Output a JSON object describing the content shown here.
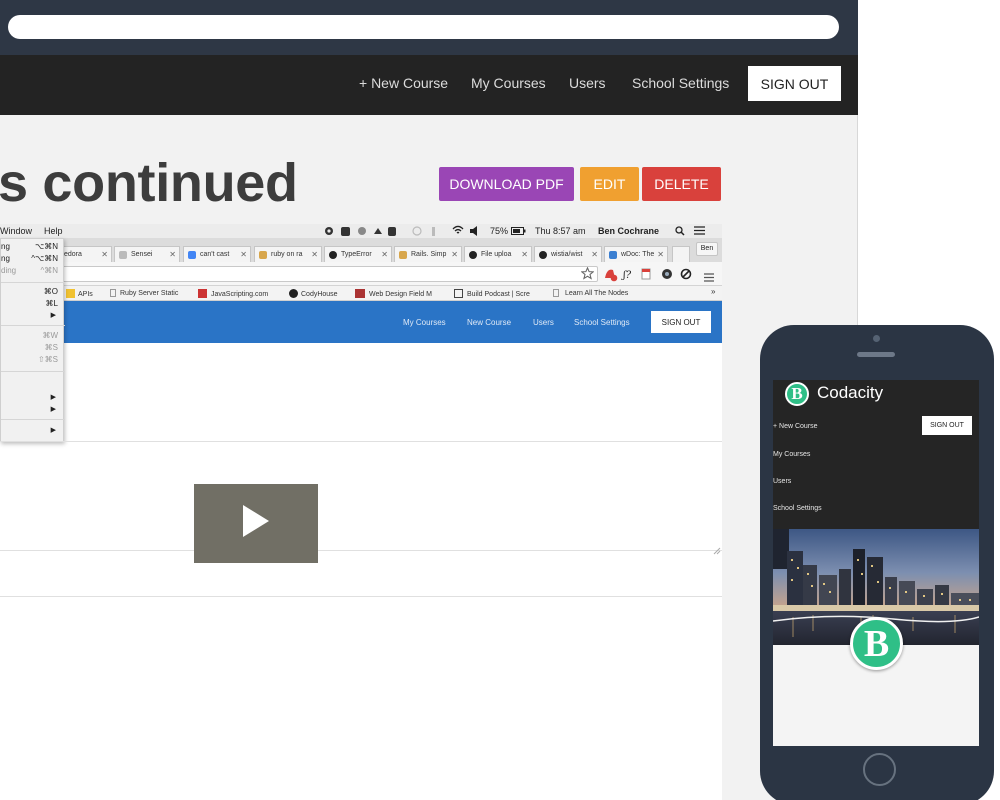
{
  "colors": {
    "browser_chrome": "#2e3745",
    "nav_bg": "#232323",
    "download_pdf": "#9a46b5",
    "edit": "#f0a030",
    "delete": "#d9413c",
    "inner_nav": "#2a74c6",
    "brand_green": "#2fbf87",
    "phone_body": "#2b3544"
  },
  "nav": {
    "new_course": "+ New Course",
    "my_courses": "My Courses",
    "users": "Users",
    "school_settings": "School Settings",
    "sign_out": "SIGN OUT"
  },
  "page": {
    "title": "s continued",
    "download_pdf": "DOWNLOAD PDF",
    "edit": "EDIT",
    "delete": "DELETE"
  },
  "screenshot": {
    "menubar": {
      "window": "Window",
      "help": "Help",
      "battery": "75%",
      "time": "Thu 8:57 am",
      "user": "Ben Cochrane"
    },
    "tabs": [
      "edora",
      "Sensei",
      "can't cast",
      "ruby on ra",
      "TypeError",
      "Rails. Simp",
      "File uploa",
      "wistia/wist",
      "wDoc: The"
    ],
    "profile": "Ben",
    "bookmarks": [
      "APIs",
      "Ruby Server Static",
      "JavaScripting.com",
      "CodyHouse",
      "Web Design Field M",
      "Build Podcast | Scre",
      "Learn All The Nodes"
    ],
    "menu": {
      "item1": "ng",
      "item1_shortcut": "⌥⌘N",
      "item2": "ng",
      "item2_shortcut": "^⌥⌘N",
      "item3": "ding",
      "item3_shortcut": "^⌘N",
      "shortcut4": "⌘O",
      "shortcut5": "⌘L",
      "shortcut6": "⌘W",
      "shortcut7": "⌘S",
      "shortcut8": "⇧⌘S",
      "arrow": "▶"
    },
    "inner_nav": {
      "my_courses": "My Courses",
      "new_course": "New Course",
      "users": "Users",
      "school_settings": "School Settings",
      "sign_out": "SIGN OUT"
    }
  },
  "mobile": {
    "logo_letter": "B",
    "brand": "Codacity",
    "sign_out": "SIGN OUT",
    "links": {
      "new_course": "+ New Course",
      "my_courses": "My Courses",
      "users": "Users",
      "school_settings": "School Settings"
    },
    "badge_letter": "B"
  },
  "icons": [
    "play-icon",
    "star-icon",
    "search-icon",
    "wifi-icon",
    "volume-icon",
    "battery-icon",
    "list-icon",
    "hamburger-menu-icon"
  ]
}
